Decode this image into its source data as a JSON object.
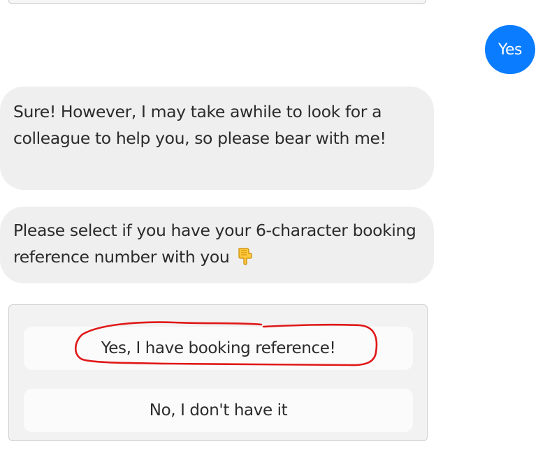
{
  "chat": {
    "user_reply": "Yes",
    "bot_message_1": "Sure! However, I may take awhile to look for a colleague to help you, so please bear with me!",
    "bot_message_2": "Please select if you have your 6-character booking reference number with you",
    "pointing_icon": "backhand-index-pointing-down-icon"
  },
  "quick_replies": [
    "Yes, I have booking reference!",
    "No, I don't have it"
  ],
  "colors": {
    "user_bubble": "#0a7cff",
    "bot_bubble": "#efefef",
    "annotation": "#e01818"
  }
}
